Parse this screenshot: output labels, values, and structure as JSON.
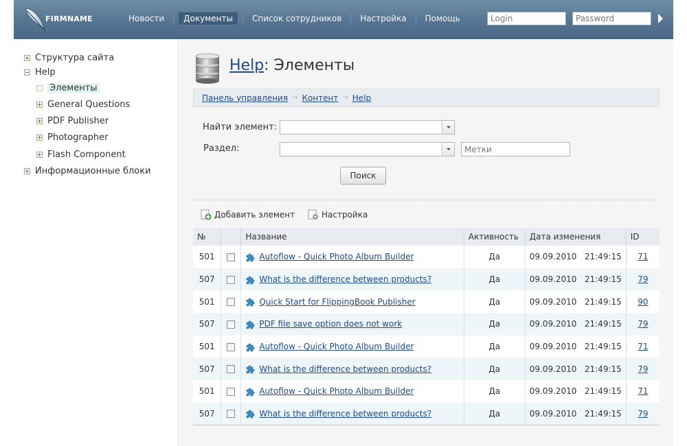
{
  "header": {
    "firmname": "FIRMNAME",
    "nav": [
      "Новости",
      "Документы",
      "Список сотрудников",
      "Настройка",
      "Помощь"
    ],
    "active_nav": "Документы",
    "login_placeholder": "Login",
    "password_placeholder": "Password"
  },
  "sidebar": {
    "items": [
      {
        "label": "Структура сайта",
        "state": "collapsed",
        "level": 0
      },
      {
        "label": "Help",
        "state": "expanded",
        "level": 0
      },
      {
        "label": "Элементы",
        "state": "leaf",
        "level": 1,
        "selected": true
      },
      {
        "label": "General Questions",
        "state": "collapsed",
        "level": 1
      },
      {
        "label": "PDF Publisher",
        "state": "collapsed",
        "level": 1
      },
      {
        "label": "Photographer",
        "state": "collapsed",
        "level": 1
      },
      {
        "label": "Flash Component",
        "state": "collapsed",
        "level": 1
      },
      {
        "label": "Информационные блоки",
        "state": "collapsed",
        "level": 0
      }
    ]
  },
  "main": {
    "title_link": "Help",
    "title_rest": ": Элементы",
    "breadcrumbs": [
      "Панель управления",
      "Контент",
      "Help"
    ],
    "form": {
      "find_label": "Найти элемент:",
      "section_label": "Раздел:",
      "tags_placeholder": "Метки",
      "search_button": "Поиск"
    },
    "toolbar": {
      "add_label": "Добавить элемент",
      "settings_label": "Настройка"
    },
    "table": {
      "headers": [
        "№",
        "",
        "Название",
        "Активность",
        "Дата изменения",
        "ID"
      ],
      "rows": [
        {
          "num": "501",
          "name": "Autoflow - Quick Photo Album Builder",
          "active": "Да",
          "date": "09.09.2010   21:49:15",
          "id": "71"
        },
        {
          "num": "507",
          "name": "What is the difference between products?",
          "active": "Да",
          "date": "09.09.2010   21:49:15",
          "id": "79"
        },
        {
          "num": "501",
          "name": "Quick Start for FlippingBook Publisher",
          "active": "Да",
          "date": "09.09.2010   21:49:15",
          "id": "90"
        },
        {
          "num": "507",
          "name": "PDF file save option does not work",
          "active": "Да",
          "date": "09.09.2010   21:49:15",
          "id": "79"
        },
        {
          "num": "501",
          "name": "Autoflow - Quick Photo Album Builder",
          "active": "Да",
          "date": "09.09.2010   21:49:15",
          "id": "71"
        },
        {
          "num": "507",
          "name": "What is the difference between products?",
          "active": "Да",
          "date": "09.09.2010   21:49:15",
          "id": "79"
        },
        {
          "num": "501",
          "name": "Autoflow - Quick Photo Album Builder",
          "active": "Да",
          "date": "09.09.2010   21:49:15",
          "id": "71"
        },
        {
          "num": "507",
          "name": "What is the difference between products?",
          "active": "Да",
          "date": "09.09.2010   21:49:15",
          "id": "79"
        }
      ]
    }
  },
  "colors": {
    "header": "#557592",
    "link": "#1f4a8a",
    "row_alt": "#eef6f9",
    "puzzle_icon": "#3a8fc7",
    "add_icon": "#3aa13a"
  },
  "icons": [
    "feather-logo-icon",
    "database-icon",
    "plus-box-icon",
    "minus-box-icon",
    "add-icon",
    "settings-doc-icon",
    "puzzle-icon",
    "arrow-right-icon"
  ]
}
